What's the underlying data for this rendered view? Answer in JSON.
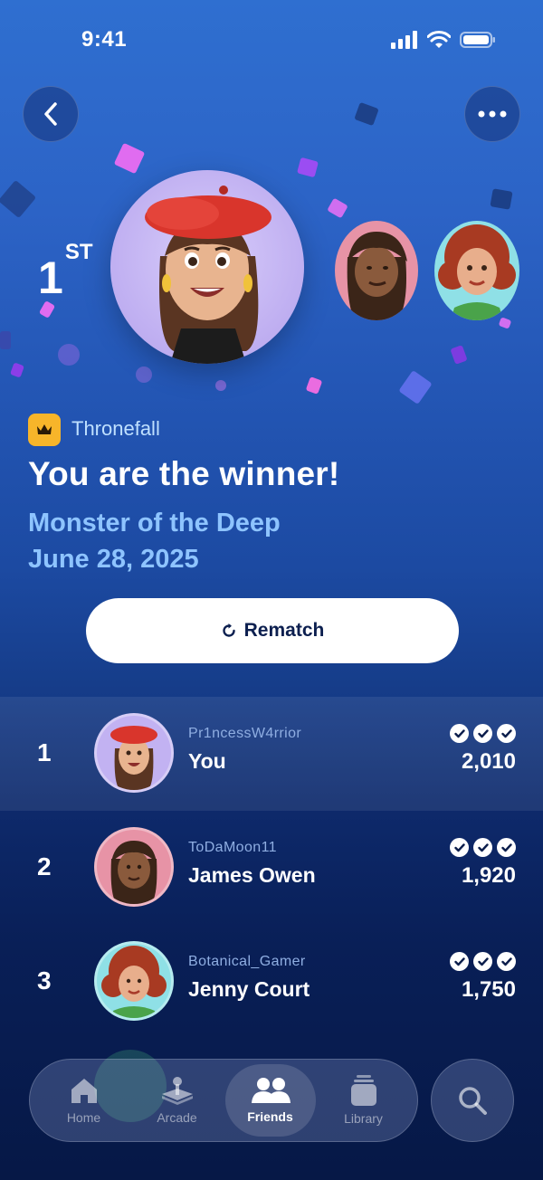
{
  "status_bar": {
    "time": "9:41"
  },
  "header": {
    "back_icon": "chevron-left-icon",
    "more_icon": "ellipsis-icon"
  },
  "hero": {
    "rank_number": "1",
    "rank_suffix": "ST"
  },
  "game": {
    "name": "Thronefall",
    "badge_icon": "crown-icon",
    "badge_color": "#f7b52a"
  },
  "result": {
    "title": "You are the winner!",
    "mode": "Monster of the Deep",
    "date": "June 28, 2025"
  },
  "rematch": {
    "label": "Rematch",
    "icon": "rotate-icon"
  },
  "leaderboard": [
    {
      "rank": "1",
      "handle": "Pr1ncessW4rrior",
      "name": "You",
      "score": "2,010",
      "checks": 3,
      "avatar_color": "#c2b2f2"
    },
    {
      "rank": "2",
      "handle": "ToDaMoon11",
      "name": "James Owen",
      "score": "1,920",
      "checks": 3,
      "avatar_color": "#e793a6"
    },
    {
      "rank": "3",
      "handle": "Botanical_Gamer",
      "name": "Jenny Court",
      "score": "1,750",
      "checks": 3,
      "avatar_color": "#8fe0e6"
    }
  ],
  "tabs": [
    {
      "label": "Home",
      "icon": "house-icon",
      "active": false
    },
    {
      "label": "Arcade",
      "icon": "joystick-icon",
      "active": false
    },
    {
      "label": "Friends",
      "icon": "people-icon",
      "active": true
    },
    {
      "label": "Library",
      "icon": "stack-icon",
      "active": false
    }
  ],
  "search": {
    "icon": "search-icon"
  },
  "colors": {
    "accent": "#8ec4ff",
    "background_top": "#2f6fd0",
    "background_bottom": "#061846"
  }
}
